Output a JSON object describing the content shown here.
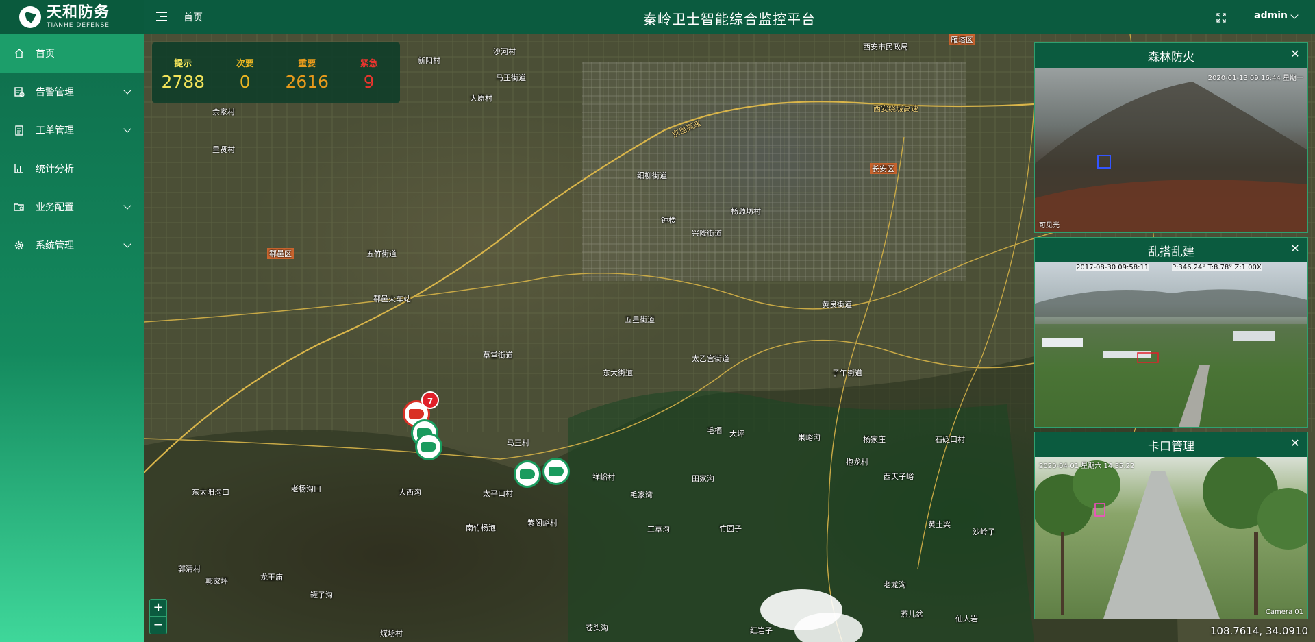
{
  "app": {
    "logo_cn": "天和防务",
    "logo_en": "TIANHE DEFENSE",
    "title": "秦岭卫士智能综合监控平台"
  },
  "header": {
    "breadcrumb": "首页",
    "user": "admin"
  },
  "sidebar": {
    "items": [
      {
        "label": "首页",
        "icon": "home-icon",
        "active": true,
        "expandable": false
      },
      {
        "label": "告警管理",
        "icon": "alarm-icon",
        "expandable": true
      },
      {
        "label": "工单管理",
        "icon": "clipboard-icon",
        "expandable": true
      },
      {
        "label": "统计分析",
        "icon": "chart-icon",
        "expandable": false
      },
      {
        "label": "业务配置",
        "icon": "folder-icon",
        "expandable": true
      },
      {
        "label": "系统管理",
        "icon": "gear-icon",
        "expandable": true
      }
    ]
  },
  "stats": [
    {
      "label": "提示",
      "value": "2788",
      "color": "#f2e35a"
    },
    {
      "label": "次要",
      "value": "0",
      "color": "#e9b522"
    },
    {
      "label": "重要",
      "value": "2616",
      "color": "#e69a1c"
    },
    {
      "label": "紧急",
      "value": "9",
      "color": "#e8352e"
    }
  ],
  "cameras": [
    {
      "title": "森林防火",
      "timestamp": "2020-01-13 09:16:44 星期一",
      "caption": "可见光"
    },
    {
      "title": "乱搭乱建",
      "timestamp": "2017-08-30 09:58:11",
      "caption": "P:346.24°  T:8.78°  Z:1.00X"
    },
    {
      "title": "卡口管理",
      "timestamp": "2020-04-01 星期六 14:35:22",
      "caption": "Camera 01"
    }
  ],
  "map": {
    "coordinates": "108.7614, 34.0910",
    "zoom_in": "+",
    "zoom_out": "−",
    "marker_badge": "7",
    "places": [
      {
        "name": "新阳村"
      },
      {
        "name": "沙河村"
      },
      {
        "name": "马王街道"
      },
      {
        "name": "大原村"
      },
      {
        "name": "余家村"
      },
      {
        "name": "里贤村"
      },
      {
        "name": "西安市民政局"
      },
      {
        "name": "雁塔区"
      },
      {
        "name": "西安绕城高速"
      },
      {
        "name": "京昆高速"
      },
      {
        "name": "长安区"
      },
      {
        "name": "鄠邑区"
      },
      {
        "name": "鄠邑火车站"
      },
      {
        "name": "五竹街道"
      },
      {
        "name": "草堂街道"
      },
      {
        "name": "太平口村"
      },
      {
        "name": "东太阳沟口"
      },
      {
        "name": "老杨沟口"
      },
      {
        "name": "大西沟"
      },
      {
        "name": "南竹杨泡"
      },
      {
        "name": "紫阁峪村"
      },
      {
        "name": "毛家湾"
      },
      {
        "name": "毛栖"
      },
      {
        "name": "大坪"
      },
      {
        "name": "田家沟"
      },
      {
        "name": "果峪沟"
      },
      {
        "name": "杨家庄"
      },
      {
        "name": "石砭口村"
      },
      {
        "name": "抱龙村"
      },
      {
        "name": "西天子峪"
      },
      {
        "name": "黄土梁"
      },
      {
        "name": "沙岭子"
      },
      {
        "name": "老龙沟"
      },
      {
        "name": "燕儿盆"
      },
      {
        "name": "仙人岩"
      },
      {
        "name": "红岩子"
      },
      {
        "name": "苍头沟"
      },
      {
        "name": "煤场村"
      },
      {
        "name": "罐子沟"
      },
      {
        "name": "郭家坪"
      },
      {
        "name": "郭清村"
      },
      {
        "name": "龙王庙"
      },
      {
        "name": "东大街道"
      },
      {
        "name": "细柳街道"
      },
      {
        "name": "兴隆街道"
      },
      {
        "name": "杨源坊村"
      },
      {
        "name": "太乙宫街道"
      },
      {
        "name": "子午街道"
      },
      {
        "name": "黄良街道"
      },
      {
        "name": "五星街道"
      },
      {
        "name": "马王村"
      },
      {
        "name": "钟楼"
      },
      {
        "name": "祥峪村"
      },
      {
        "name": "工草沟"
      },
      {
        "name": "竹园子"
      }
    ]
  }
}
